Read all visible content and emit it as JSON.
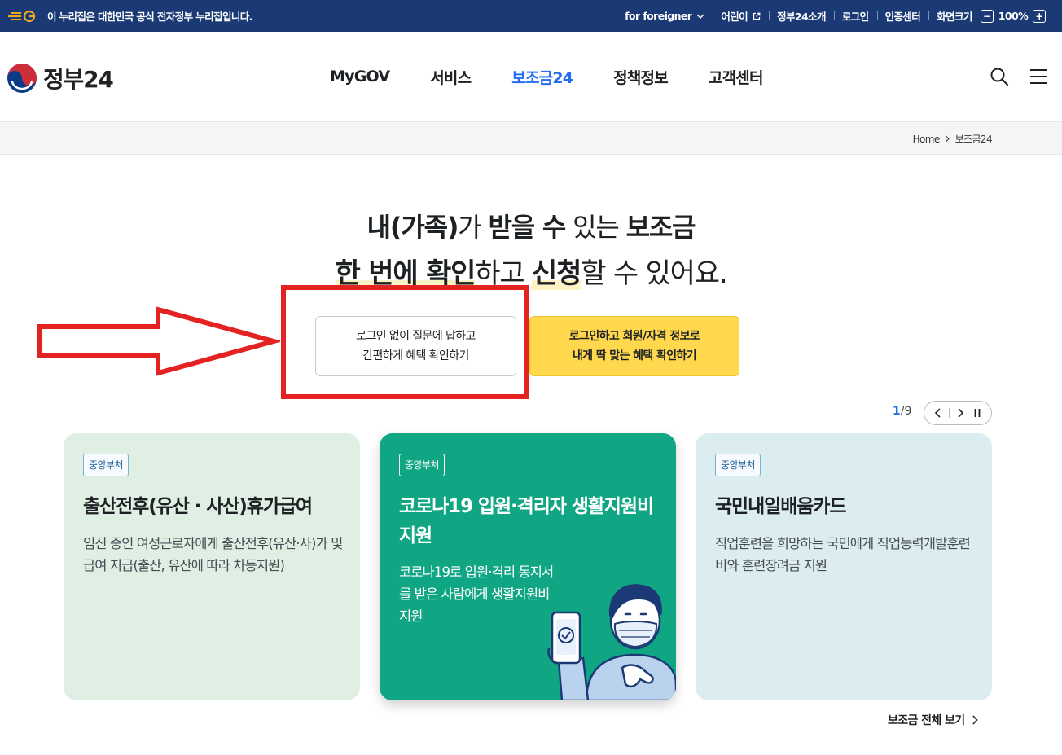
{
  "topbar": {
    "notice": "이 누리집은 대한민국 공식 전자정부 누리집입니다.",
    "items": [
      {
        "label": "for foreigner"
      },
      {
        "label": "어린이"
      },
      {
        "label": "정부24소개"
      },
      {
        "label": "로그인"
      },
      {
        "label": "인증센터"
      },
      {
        "label": "화면크기"
      }
    ],
    "zoom": {
      "minus": "−",
      "value": "100%",
      "plus": "+"
    }
  },
  "header": {
    "logo_text": "정부24",
    "nav": [
      {
        "label": "MyGOV"
      },
      {
        "label": "서비스"
      },
      {
        "label": "보조금24"
      },
      {
        "label": "정책정보"
      },
      {
        "label": "고객센터"
      }
    ]
  },
  "breadcrumb": {
    "home": "Home",
    "current": "보조금24"
  },
  "hero": {
    "line1": {
      "p1": "내(가족)",
      "p2": "가 ",
      "p3": "받을 수",
      "p4": " 있는 ",
      "p5": "보조금"
    },
    "line2": {
      "p1": "한 번에 확인",
      "p2": "하고 ",
      "p3": "신청",
      "p4": "할 수 있어요."
    }
  },
  "cta": {
    "nologin": {
      "line1": "로그인 없이 질문에 답하고",
      "line2": "간편하게 혜택 확인하기"
    },
    "login": {
      "line1": "로그인하고 회원/자격 정보로",
      "line2": "내게 딱 맞는 혜택 확인하기"
    }
  },
  "pager": {
    "current": "1",
    "separator": "/",
    "total": "9"
  },
  "cards": [
    {
      "badge": "중앙부처",
      "title": "출산전후(유산 · 사산)휴가급여",
      "desc": "임신 중인 여성근로자에게 출산전후(유산·사)가 및 급여 지급(출산, 유산에 따라 차등지원)"
    },
    {
      "badge": "중앙부처",
      "title": "코로나19 입원·격리자 생활지원비 지원",
      "desc": "코로나19로 입원·격리 통지서를 받은 사람에게 생활지원비 지원"
    },
    {
      "badge": "중앙부처",
      "title": "국민내일배움카드",
      "desc": "직업훈련을 희망하는 국민에게 직업능력개발훈련비와 훈련장려금 지원"
    }
  ],
  "more_link": "보조금 전체 보기",
  "colors": {
    "topbar": "#1b3a75",
    "accent": "#256ef4",
    "cta_yellow": "#ffd84d",
    "card_green": "#10a683",
    "annotation_red": "#e52222"
  }
}
